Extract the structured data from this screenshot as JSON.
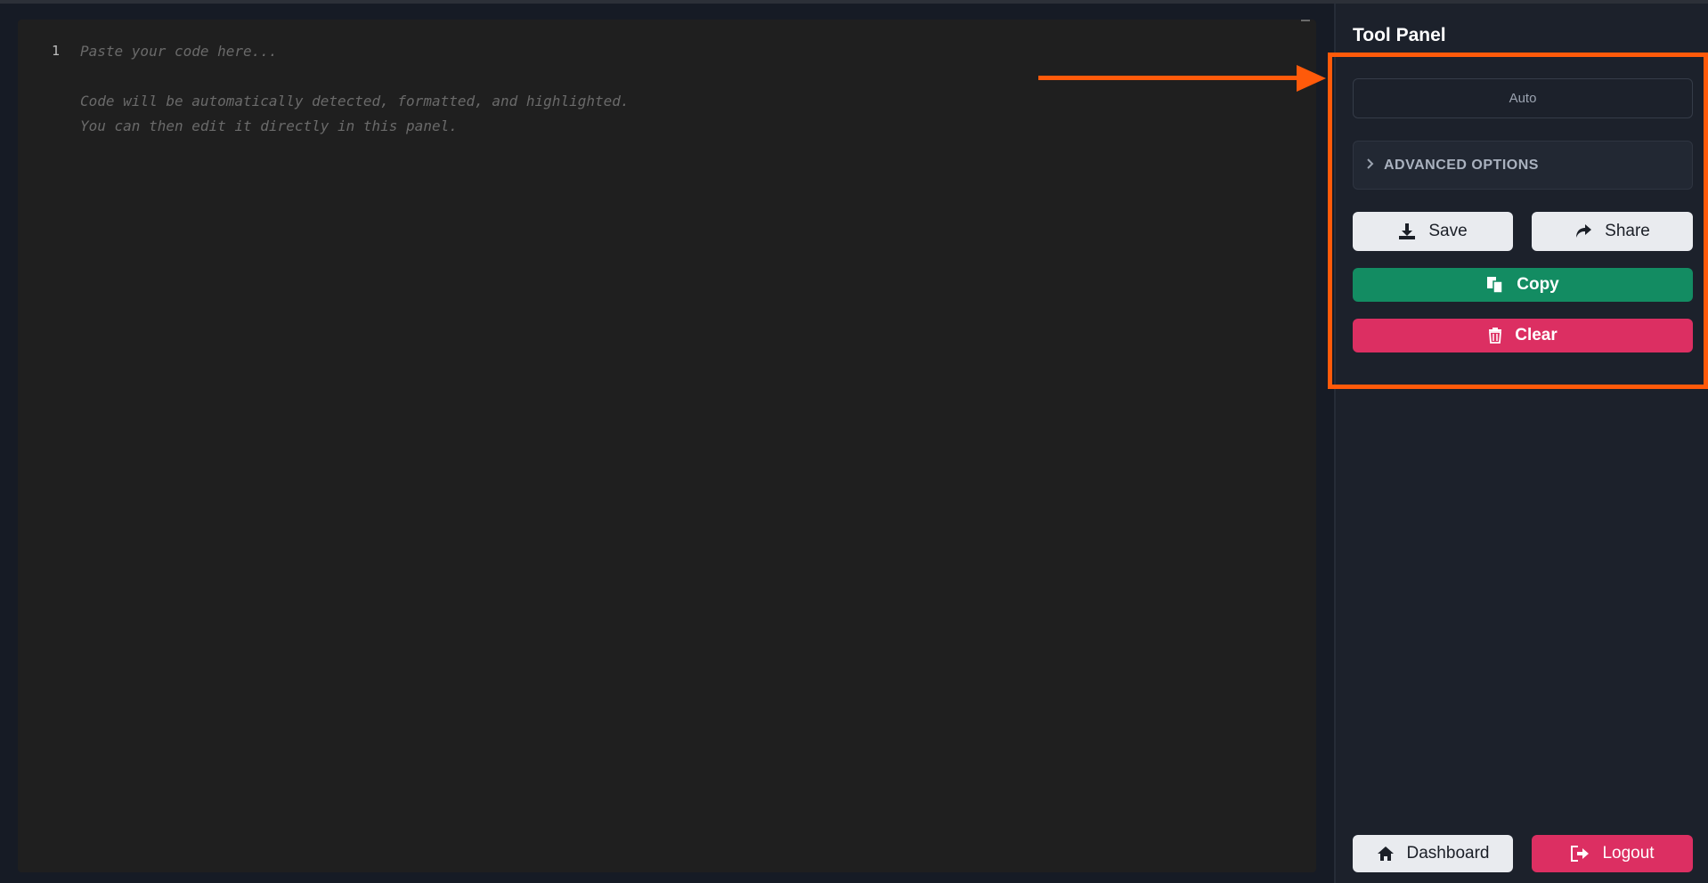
{
  "editor": {
    "line_number": "1",
    "placeholder_lines": [
      "Paste your code here...",
      "",
      "Code will be automatically detected, formatted, and highlighted.",
      "You can then edit it directly in this panel."
    ]
  },
  "sidebar": {
    "title": "Tool Panel",
    "language_select": "Auto",
    "advanced_label": "ADVANCED OPTIONS",
    "buttons": {
      "save": "Save",
      "share": "Share",
      "copy": "Copy",
      "clear": "Clear",
      "dashboard": "Dashboard",
      "logout": "Logout"
    }
  },
  "colors": {
    "accent_highlight": "#ff5a0a",
    "copy_green": "#138c62",
    "clear_red": "#dc2f62"
  },
  "icons": [
    "download-icon",
    "share-icon",
    "copy-icon",
    "trash-icon",
    "home-icon",
    "logout-icon",
    "chevron-right-icon"
  ]
}
